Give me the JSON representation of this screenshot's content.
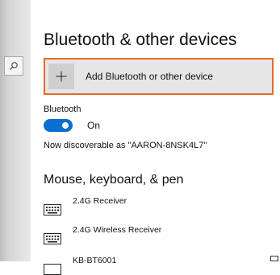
{
  "page": {
    "title": "Bluetooth & other devices"
  },
  "add_device": {
    "label": "Add Bluetooth or other device"
  },
  "bluetooth": {
    "label": "Bluetooth",
    "toggle_state": "On",
    "toggle_on": true,
    "discoverable_text": "Now discoverable as \"AARON-8NSK4L7\""
  },
  "mouse_section": {
    "title": "Mouse, keyboard, & pen",
    "devices": [
      {
        "name": "2.4G Receiver",
        "icon": "keyboard-icon"
      },
      {
        "name": "2.4G Wireless Receiver",
        "icon": "keyboard-icon"
      },
      {
        "name": "KB-BT6001",
        "icon": "keyboard-icon"
      }
    ]
  },
  "colors": {
    "accent": "#0a6fd0",
    "focus_border": "#e36c2a",
    "add_button_bg": "#e6e6e6"
  }
}
